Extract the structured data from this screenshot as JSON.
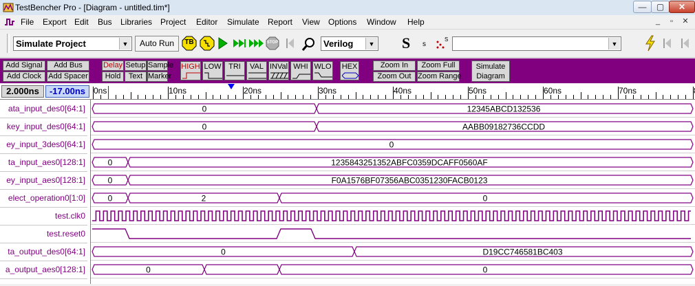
{
  "window": {
    "title": "TestBencher Pro - [Diagram - untitled.tim*]",
    "controls": {
      "minimize": "—",
      "maximize": "▢",
      "close": "✕"
    }
  },
  "menu": {
    "items": [
      "File",
      "Export",
      "Edit",
      "Bus",
      "Libraries",
      "Project",
      "Editor",
      "Simulate",
      "Report",
      "View",
      "Options",
      "Window",
      "Help"
    ],
    "mdi_controls": [
      "_",
      "▫",
      "✕"
    ]
  },
  "toolbar": {
    "project_combo": "Simulate Project",
    "auto_run_label": "Auto Run",
    "tb_label": "TB",
    "stop_label": "STOP",
    "language_combo": "Verilog",
    "s_big": "S",
    "s_small": "s",
    "s_super": "S",
    "lookup_value": ""
  },
  "toolbar2": {
    "add_signal": "Add Signal",
    "add_bus": "Add Bus",
    "add_clock": "Add Clock",
    "add_spacer": "Add Spacer",
    "delay": "Delay",
    "setup": "Setup",
    "sample": "Sample",
    "hold": "Hold",
    "text": "Text",
    "marker": "Marker",
    "high": "HIGH",
    "low": "LOW",
    "tri": "TRI",
    "val": "VAL",
    "inval": "INVal",
    "whi": "WHI",
    "wlo": "WLO",
    "hex": "HEX",
    "zoom_in": "Zoom In",
    "zoom_out": "Zoom Out",
    "zoom_full": "Zoom Full",
    "zoom_range": "Zoom Range",
    "simulate_diagram_1": "Simulate",
    "simulate_diagram_2": "Diagram"
  },
  "timeline": {
    "cursor_time": "2.000ns",
    "delta_time": "-17.00ns",
    "ticks": [
      "0ns",
      "10ns",
      "20ns",
      "30ns",
      "40ns",
      "50ns",
      "60ns",
      "70ns",
      "8"
    ],
    "marker_color": "#0000ff"
  },
  "colors": {
    "signal": "#800080",
    "toolbar2_bg": "#800080",
    "delta_fg": "#0000c0"
  },
  "signals": [
    {
      "name": "ata_input_des0[64:1]",
      "kind": "bus",
      "segments": [
        {
          "value": "0"
        },
        {
          "value": "12345ABCD132536"
        }
      ]
    },
    {
      "name": "key_input_des0[64:1]",
      "kind": "bus",
      "segments": [
        {
          "value": "0"
        },
        {
          "value": "AABB09182736CCDD"
        }
      ]
    },
    {
      "name": "ey_input_3des0[64:1]",
      "kind": "bus",
      "segments": [
        {
          "value": "0"
        }
      ]
    },
    {
      "name": "ta_input_aes0[128:1]",
      "kind": "bus",
      "segments": [
        {
          "value": "0"
        },
        {
          "value": "1235843251352ABFC0359DCAFF0560AF"
        }
      ]
    },
    {
      "name": "ey_input_aes0[128:1]",
      "kind": "bus",
      "segments": [
        {
          "value": "0"
        },
        {
          "value": "F0A1576BF07356ABC0351230FACB0123"
        }
      ]
    },
    {
      "name": "elect_operation0[1:0]",
      "kind": "bus",
      "segments": [
        {
          "value": "0"
        },
        {
          "value": "2"
        },
        {
          "value": "0"
        }
      ]
    },
    {
      "name": "test.clk0",
      "kind": "clock"
    },
    {
      "name": "test.reset0",
      "kind": "bit"
    },
    {
      "name": "ta_output_des0[64:1]",
      "kind": "bus",
      "segments": [
        {
          "value": "0"
        },
        {
          "value": "D19CC746581BC403"
        }
      ]
    },
    {
      "name": "a_output_aes0[128:1]",
      "kind": "bus",
      "segments": [
        {
          "value": "0"
        },
        {
          "value": ""
        },
        {
          "value": "0"
        }
      ]
    }
  ]
}
